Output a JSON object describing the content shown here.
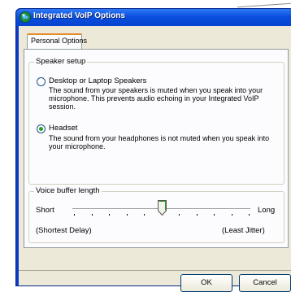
{
  "window": {
    "title": "Integrated VoIP Options"
  },
  "tabs": [
    {
      "label": "Personal Options",
      "selected": true
    }
  ],
  "speaker_setup": {
    "legend": "Speaker setup",
    "options": [
      {
        "label": "Desktop or Laptop Speakers",
        "description": "The sound from your speakers is muted when you speak into your microphone. This prevents audio echoing in your Integrated VoIP session.",
        "selected": false
      },
      {
        "label": "Headset",
        "description": "The sound from your headphones is not muted when you speak into your microphone.",
        "selected": true
      }
    ]
  },
  "voice_buffer": {
    "legend": "Voice buffer length",
    "min_label": "Short",
    "max_label": "Long",
    "min_caption": "(Shortest Delay)",
    "max_caption": "(Least Jitter)",
    "tick_count": 11,
    "value_fraction": 0.5
  },
  "buttons": {
    "ok": "OK",
    "cancel": "Cancel"
  },
  "colors": {
    "title_bar": "#0a4fe0",
    "selected_radio": "#21a121",
    "active_tab_accent": "#e68b2c"
  }
}
